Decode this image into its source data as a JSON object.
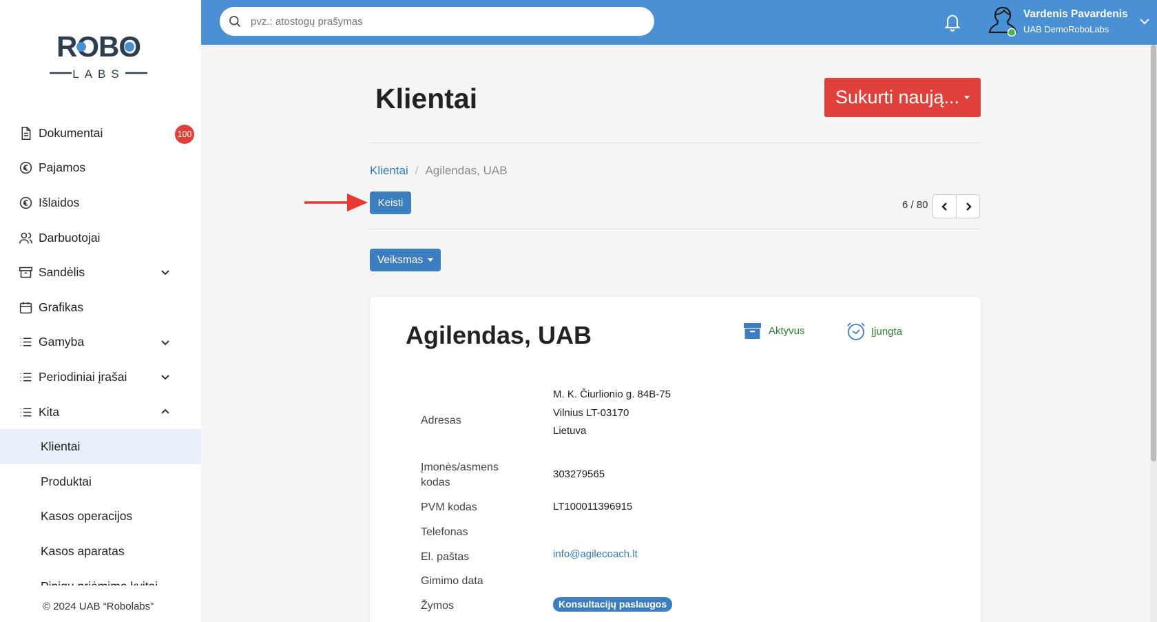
{
  "sidebar": {
    "logo": {
      "top": "ROBO",
      "bottom": "LABS"
    },
    "items": [
      {
        "label": "Dokumentai",
        "badge": "100"
      },
      {
        "label": "Pajamos"
      },
      {
        "label": "Išlaidos"
      },
      {
        "label": "Darbuotojai"
      },
      {
        "label": "Sandėlis"
      },
      {
        "label": "Grafikas"
      },
      {
        "label": "Gamyba"
      },
      {
        "label": "Periodiniai įrašai"
      },
      {
        "label": "Kita"
      }
    ],
    "sub_items": [
      {
        "label": "Klientai"
      },
      {
        "label": "Produktai"
      },
      {
        "label": "Kasos operacijos"
      },
      {
        "label": "Kasos aparatas"
      },
      {
        "label": "Pinigų priėmimo kvitai"
      }
    ],
    "copyright": "© 2024 UAB “Robolabs”"
  },
  "topbar": {
    "search_placeholder": "pvz.: atostogų prašymas",
    "user_name": "Vardenis Pavardenis",
    "user_company": "UAB DemoRoboLabs"
  },
  "main": {
    "title": "Klientai",
    "create_label": "Sukurti naują...",
    "breadcrumb": {
      "parent": "Klientai",
      "separator": "/",
      "current": "Agilendas, UAB"
    },
    "edit_label": "Keisti",
    "pager": "6 / 80",
    "action_label": "Veiksmas"
  },
  "card": {
    "name": "Agilendas, UAB",
    "status_active": "Aktyvus",
    "status_enabled": "Įjungta",
    "fields": {
      "address_label": "Adresas",
      "address_line1": "M. K. Čiurlionio g. 84B-75",
      "address_line2": "Vilnius LT-03170",
      "address_line3": "Lietuva",
      "code_label_1": "Įmonės/asmens",
      "code_label_2": "kodas",
      "code_value": "303279565",
      "vat_label": "PVM kodas",
      "vat_value": "LT100011396915",
      "phone_label": "Telefonas",
      "email_label": "El. paštas",
      "email_value": "info@agilecoach.lt",
      "birth_label": "Gimimo data",
      "tags_label": "Žymos",
      "tag_value": "Konsultacijų paslaugos"
    }
  },
  "colors": {
    "topbar": "#4a90d4",
    "primary_button": "#3d7ec0",
    "danger": "#e0413b",
    "active_nav": "#e8f1fa",
    "status_green": "#2e7d32"
  }
}
